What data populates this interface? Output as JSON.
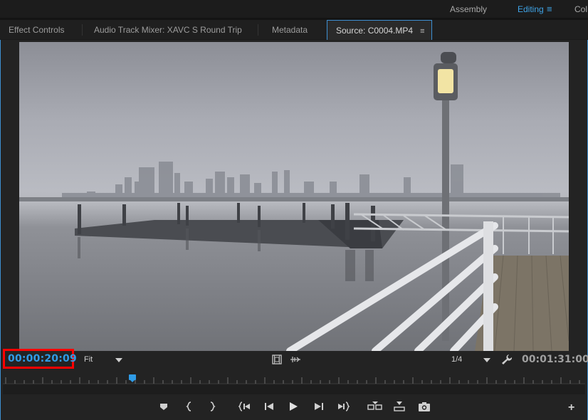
{
  "workspaces": {
    "items": [
      {
        "label": "Assembly",
        "active": false
      },
      {
        "label": "Editing",
        "active": true
      },
      {
        "label": "Col",
        "active": false
      }
    ],
    "menu_icon": "hamburger-icon"
  },
  "tabs": [
    {
      "label": "Effect Controls",
      "active": false
    },
    {
      "label": "Audio Track Mixer: XAVC S Round Trip",
      "active": false
    },
    {
      "label": "Metadata",
      "active": false
    },
    {
      "label": "Source: C0004.MP4",
      "active": true
    }
  ],
  "monitor": {
    "current_timecode": "00:00:20:09",
    "zoom_level": "Fit",
    "resolution": "1/4",
    "duration_timecode": "00:01:31:00",
    "playhead_fraction": 0.223
  },
  "icons": {
    "export_frame": "film-icon",
    "safe_margins": "waveform-icon",
    "settings": "wrench-icon",
    "add": "plus-icon"
  },
  "transport": [
    "add-marker-icon",
    "mark-in-icon",
    "mark-out-icon",
    "go-to-in-icon",
    "step-back-icon",
    "play-icon",
    "step-forward-icon",
    "go-to-out-icon",
    "insert-icon",
    "overwrite-icon",
    "export-frame-icon"
  ],
  "colors": {
    "accent": "#2f9be6",
    "highlight_box": "#ff0000",
    "panel_border": "#3d8fd1"
  }
}
